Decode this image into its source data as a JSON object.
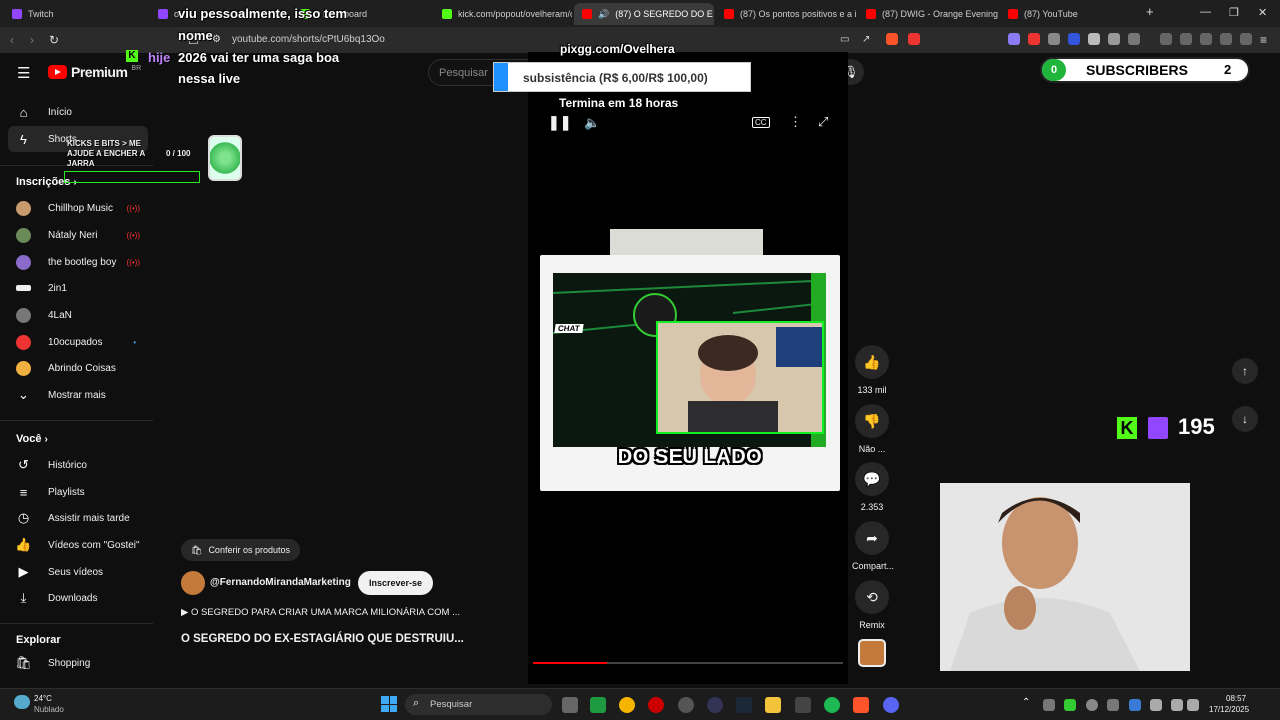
{
  "browser": {
    "tabs": [
      {
        "label": "Twitch",
        "color": "#9146ff"
      },
      {
        "label": "ove",
        "color": "#9146ff"
      },
      {
        "label": "k Dashboard",
        "color": "#53fc18"
      },
      {
        "label": "kick.com/popout/ovelheram/c",
        "color": "#53fc18"
      },
      {
        "label": "(87) O SEGREDO DO E",
        "color": "#ff0000"
      },
      {
        "label": "(87) Os pontos positivos e a inr",
        "color": "#ff0000"
      },
      {
        "label": "(87) DWIG - Orange Evening //",
        "color": "#ff0000"
      },
      {
        "label": "(87) YouTube",
        "color": "#ff0000"
      }
    ],
    "url": "youtube.com/shorts/cPtU6bq13Oo"
  },
  "youtube": {
    "logo_text": "Premium",
    "logo_region": "BR",
    "search_placeholder": "Pesquisar",
    "sidebar": {
      "main": [
        {
          "label": "Início",
          "icon": "home-icon"
        },
        {
          "label": "Shorts",
          "icon": "shorts-icon"
        }
      ],
      "subscriptions_title": "Inscrições",
      "subscriptions": [
        {
          "label": "Chillhop Music",
          "color": "#c99a6b",
          "live": true
        },
        {
          "label": "Nátaly Neri",
          "color": "#6b8a5a",
          "live": true
        },
        {
          "label": "the bootleg boy",
          "color": "#8a6bc9",
          "live": true
        },
        {
          "label": "2in1",
          "color": "#eeeeee",
          "live": false
        },
        {
          "label": "4LaN",
          "color": "#777777",
          "live": false
        },
        {
          "label": "10ocupados",
          "color": "#e33333",
          "live": false,
          "dot": true
        },
        {
          "label": "Abrindo Coisas",
          "color": "#f0b040",
          "live": false
        }
      ],
      "show_more": "Mostrar mais",
      "you_title": "Você",
      "you": [
        {
          "label": "Histórico",
          "icon": "history-icon"
        },
        {
          "label": "Playlists",
          "icon": "playlists-icon"
        },
        {
          "label": "Assistir mais tarde",
          "icon": "watch-later-icon"
        },
        {
          "label": "Vídeos com \"Gostei\"",
          "icon": "liked-icon"
        },
        {
          "label": "Seus vídeos",
          "icon": "your-videos-icon"
        },
        {
          "label": "Downloads",
          "icon": "downloads-icon"
        }
      ],
      "explore_title": "Explorar",
      "explore": [
        {
          "label": "Shopping",
          "icon": "shopping-icon"
        }
      ]
    },
    "short": {
      "caption": "DO SEU LADO",
      "chat_label": "CHAT",
      "products_label": "Conferir os produtos",
      "channel": "@FernandoMirandaMarketing",
      "subscribe": "Inscrever-se",
      "playlist_line": "▶ O SEGREDO PARA CRIAR UMA MARCA MILIONÁRIA COM ...",
      "title": "O SEGREDO DO EX-ESTAGIÁRIO QUE DESTRUIU...",
      "progress": 0.24,
      "actions": [
        {
          "label": "133 mil",
          "icon": "like-icon"
        },
        {
          "label": "Não ...",
          "icon": "dislike-icon"
        },
        {
          "label": "2.353",
          "icon": "comments-icon"
        },
        {
          "label": "Compart...",
          "icon": "share-icon"
        },
        {
          "label": "Remix",
          "icon": "remix-icon"
        }
      ]
    }
  },
  "overlay": {
    "chat_line1": "viu pessoalmente, isso tem",
    "chat_line2": "nome",
    "chat_user": "hije",
    "chat_line3": "2026 vai ter uma saga boa",
    "chat_line4": "nessa live",
    "pix_url": "pixgg.com/Ovelhera",
    "pix_goal": "subsistência (R$ 6,00/R$ 100,00)",
    "pix_ends": "Termina em 18 horas",
    "jar_label": "KICKS E BITS > ME AJUDE A ENCHER A JARRA",
    "jar_count": "0 / 100",
    "subs_count": "0",
    "subs_label": "SUBSCRIBERS",
    "subs_badge": "2",
    "kick_twitch_count": "195"
  },
  "taskbar": {
    "weather_temp": "24°C",
    "weather_desc": "Nublado",
    "search": "Pesquisar",
    "time": "08:57",
    "date": "17/12/2025"
  }
}
